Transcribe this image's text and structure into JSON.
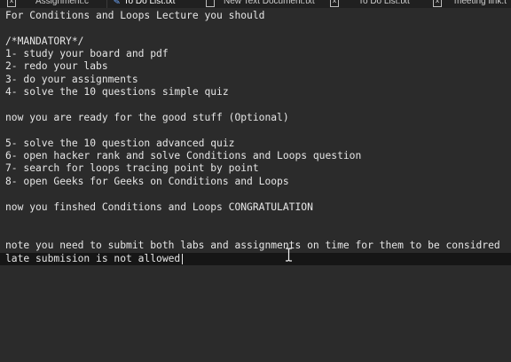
{
  "tabs": [
    {
      "label": "Assignment.c",
      "close_glyph": "x",
      "active": false
    },
    {
      "label": "To Do List.txt",
      "icon": "pencil-icon",
      "active": true
    },
    {
      "label": "New Text Document.txt",
      "close_glyph": "x",
      "active": false
    },
    {
      "label": "To Do List.txt",
      "close_glyph": "x",
      "active": false
    },
    {
      "label": "meeting link.t",
      "close_glyph": "",
      "active": false
    }
  ],
  "editor": {
    "lines": [
      "For Conditions and Loops Lecture you should",
      "",
      "/*MANDATORY*/",
      "1- study your board and pdf",
      "2- redo your labs",
      "3- do your assignments",
      "4- solve the 10 questions simple quiz",
      "",
      "now you are ready for the good stuff (Optional)",
      "",
      "5- solve the 10 question advanced quiz",
      "6- open hacker rank and solve Conditions and Loops question",
      "7- search for loops tracing point by point",
      "8- open Geeks for Geeks on Conditions and Loops",
      "",
      "now you finshed Conditions and Loops CONGRATULATION",
      "",
      "",
      "note you need to submit both labs and assignments on time for them to be considred",
      "late submision is not allowed"
    ]
  },
  "colors": {
    "background": "#2b2b2b",
    "text": "#e6e6e6",
    "current_line": "#161616",
    "tabbar": "#202020"
  }
}
